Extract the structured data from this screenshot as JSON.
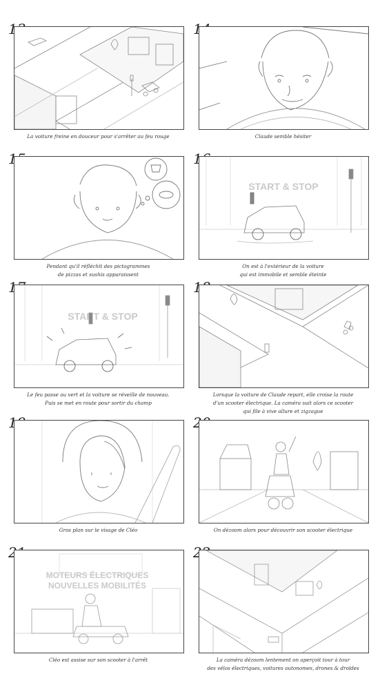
{
  "panels": [
    {
      "number": "13",
      "caption": "La voiture freine en douceur pour s'arrêter au feu rouge"
    },
    {
      "number": "14",
      "caption": "Claude semble hésiter"
    },
    {
      "number": "15",
      "caption": "Pendant qu'il réfléchit des pictogrammes\nde pizzas et sushis apparaissent"
    },
    {
      "number": "16",
      "caption": "On est à l'extérieur de la voiture\nqui est immobile et semble éteinte",
      "overlay": "START & STOP"
    },
    {
      "number": "17",
      "caption": "Le feu passe au vert et la voiture se réveille de nouveau.\nPuis se met en route pour sortir du champ",
      "overlay": "START & STOP"
    },
    {
      "number": "18",
      "caption": "Lorsque la voiture de Claude repart, elle croise la route\nd'un scooter électrique. La caméra suit alors ce scooter\nqui file à vive allure et zigzague"
    },
    {
      "number": "19",
      "caption": "Gros plan sur le visage de Cléo"
    },
    {
      "number": "20",
      "caption": "On dézoom alors pour découvrir son scooter électrique"
    },
    {
      "number": "21",
      "caption": "Cléo est assise sur son scooter à l'arrêt",
      "overlay_line1": "MOTEURS ÉLECTRIQUES",
      "overlay_line2": "NOUVELLES MOBILITÉS"
    },
    {
      "number": "22",
      "caption": "La caméra dézoom lentement on aperçoit tour à tour\ndes vélos électriques, voitures autonomes, drones & droïdes"
    }
  ]
}
